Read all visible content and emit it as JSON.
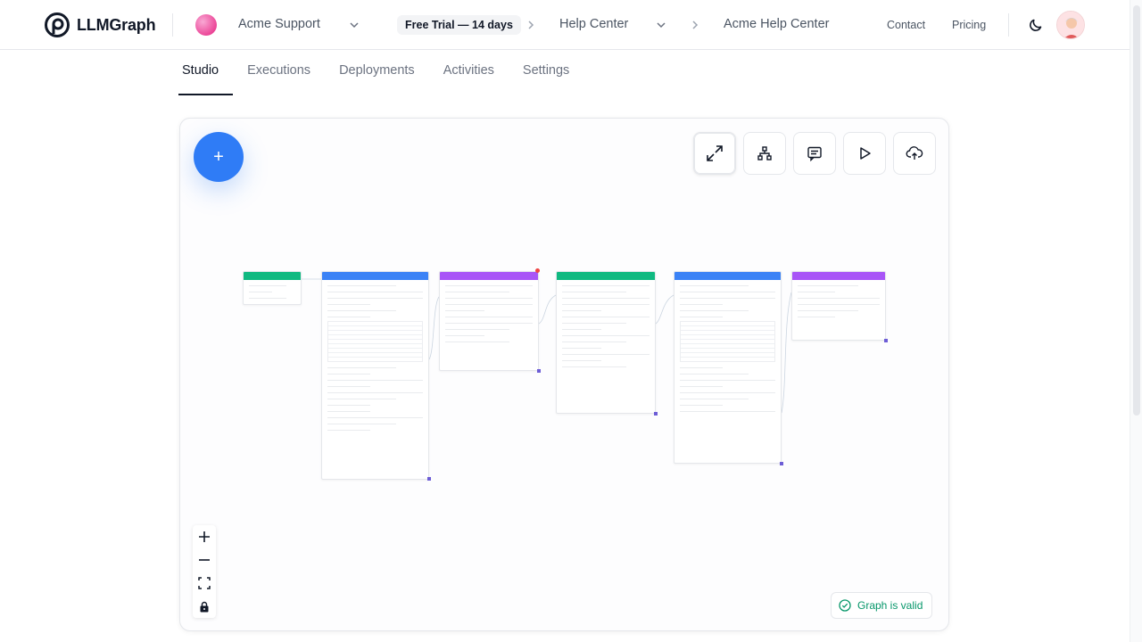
{
  "header": {
    "brand": "LLMGraph",
    "org_name": "Acme Support",
    "trial_badge": "Free Trial — 14 days",
    "project_name": "Help Center",
    "current_page": "Acme Help Center",
    "contact_label": "Contact",
    "pricing_label": "Pricing"
  },
  "tabs": [
    {
      "label": "Studio",
      "active": true
    },
    {
      "label": "Executions",
      "active": false
    },
    {
      "label": "Deployments",
      "active": false
    },
    {
      "label": "Activities",
      "active": false
    },
    {
      "label": "Settings",
      "active": false
    }
  ],
  "canvas": {
    "add_button": "+",
    "toolbar_icons": [
      "expand-icon",
      "hierarchy-icon",
      "message-icon",
      "play-icon",
      "upload-cloud-icon"
    ],
    "zoom_icons": [
      "plus-icon",
      "minus-icon",
      "fit-view-icon",
      "lock-icon"
    ],
    "status_label": "Graph is valid",
    "node_colors": {
      "input": "#10b981",
      "prompt": "#3b82f6",
      "llm": "#a855f7",
      "router": "#10b981"
    }
  },
  "colors": {
    "accent": "#2f7cf6",
    "success": "#059669",
    "text": "#1f2937"
  }
}
